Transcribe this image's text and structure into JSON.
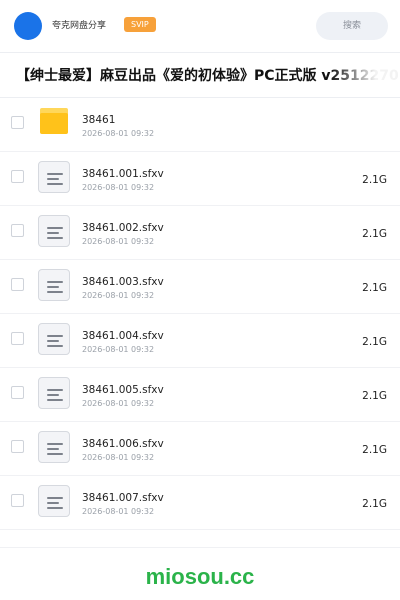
{
  "header": {
    "username": "夸克网盘分享",
    "badge": "SVIP",
    "search_placeholder": "搜索",
    "accent": "#1a73e8",
    "badge_color": "#f7a13a"
  },
  "share": {
    "title": "【绅士最爱】麻豆出品《爱的初体验》PC正式版 v2512270"
  },
  "files": [
    {
      "name": "38461",
      "date": "2026-08-01 09:32",
      "size": "",
      "type": "folder-icon"
    },
    {
      "name": "38461.001.sfxv",
      "date": "2026-08-01 09:32",
      "size": "2.1G",
      "type": "document-icon"
    },
    {
      "name": "38461.002.sfxv",
      "date": "2026-08-01 09:32",
      "size": "2.1G",
      "type": "document-icon"
    },
    {
      "name": "38461.003.sfxv",
      "date": "2026-08-01 09:32",
      "size": "2.1G",
      "type": "document-icon"
    },
    {
      "name": "38461.004.sfxv",
      "date": "2026-08-01 09:32",
      "size": "2.1G",
      "type": "document-icon"
    },
    {
      "name": "38461.005.sfxv",
      "date": "2026-08-01 09:32",
      "size": "2.1G",
      "type": "document-icon"
    },
    {
      "name": "38461.006.sfxv",
      "date": "2026-08-01 09:32",
      "size": "2.1G",
      "type": "document-icon"
    },
    {
      "name": "38461.007.sfxv",
      "date": "2026-08-01 09:32",
      "size": "2.1G",
      "type": "document-icon"
    }
  ],
  "footer": {
    "watermark": "miosou.cc",
    "watermark_color": "#2bb34a"
  }
}
